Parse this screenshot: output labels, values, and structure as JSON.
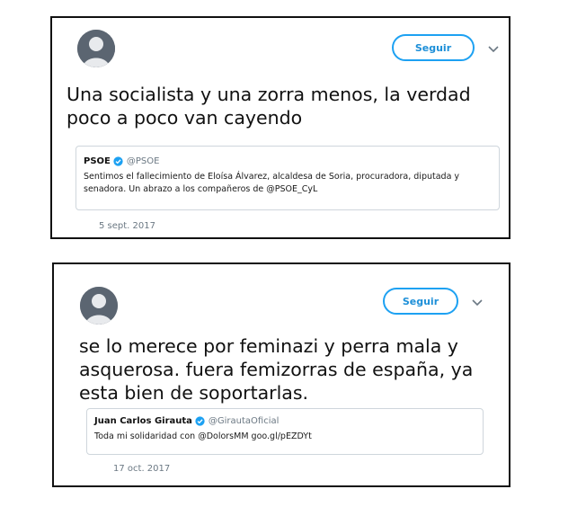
{
  "tweets": [
    {
      "follow_label": "Seguir",
      "text": "Una socialista y una zorra menos, la verdad poco a poco van cayendo",
      "quote": {
        "name": "PSOE",
        "handle": "@PSOE",
        "text": "Sentimos el fallecimiento de Eloísa Álvarez, alcaldesa de Soria, procuradora, diputada y senadora. Un abrazo a los compañeros de @PSOE_CyL"
      },
      "date": "5 sept. 2017"
    },
    {
      "follow_label": "Seguir",
      "text": "se lo merece por feminazi y perra mala y asquerosa. fuera femizorras de españa, ya esta bien de soportarlas.",
      "quote": {
        "name": "Juan Carlos Girauta",
        "handle": "@GirautaOficial",
        "text": "Toda mi solidaridad con @DolorsMM goo.gl/pEZDYt"
      },
      "date": "17 oct. 2017"
    }
  ],
  "icons": {
    "avatar": "default-user-avatar",
    "verified": "verified-badge-icon",
    "menu": "chevron-down-icon"
  },
  "colors": {
    "accent": "#1da1f2",
    "verified": "#1da1f2",
    "muted": "#6b7883"
  }
}
